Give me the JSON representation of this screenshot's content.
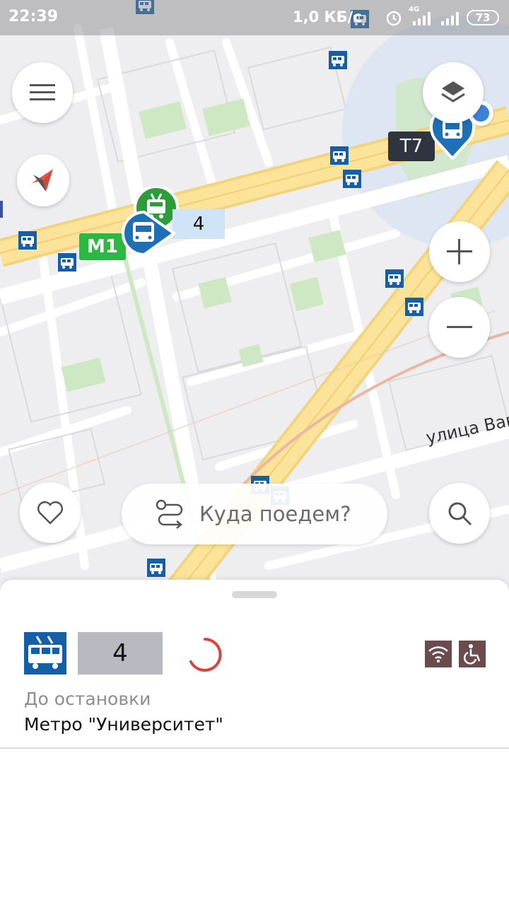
{
  "status_bar": {
    "time": "22:39",
    "network_speed": "1,0 КБ/с",
    "network_type": "4G",
    "battery": "73"
  },
  "map": {
    "street_name": "улица Вав",
    "metro_label": "М1",
    "route_chip_label": "4",
    "stop_chip_label": "Т7",
    "colors": {
      "background": "#eeeef0",
      "major_road": "#fbe39a",
      "park": "#cfe8c4",
      "metro_badge": "#2db843",
      "bus_marker": "#1e6fb6",
      "trolley_marker": "#2d9c3b",
      "stop_icon": "#145fa5"
    }
  },
  "controls": {
    "menu_icon": "hamburger-icon",
    "compass_icon": "compass-icon",
    "layers_icon": "layers-icon",
    "zoom_in_icon": "plus-icon",
    "zoom_out_icon": "minus-icon",
    "favorite_icon": "heart-icon",
    "search_icon": "search-icon"
  },
  "search": {
    "placeholder": "Куда поедем?"
  },
  "sheet": {
    "vehicle_type": "trolleybus-icon",
    "route_number": "4",
    "to_stop_label": "До остановки",
    "stop_name": "Метро \"Университет\"",
    "features": [
      "wifi-icon",
      "wheelchair-icon"
    ],
    "colors": {
      "vehicle_bg": "#145fa5",
      "route_bg": "#b9b9c2",
      "spinner": "#d9433b",
      "feature_bg": "#6b4b4d"
    }
  }
}
